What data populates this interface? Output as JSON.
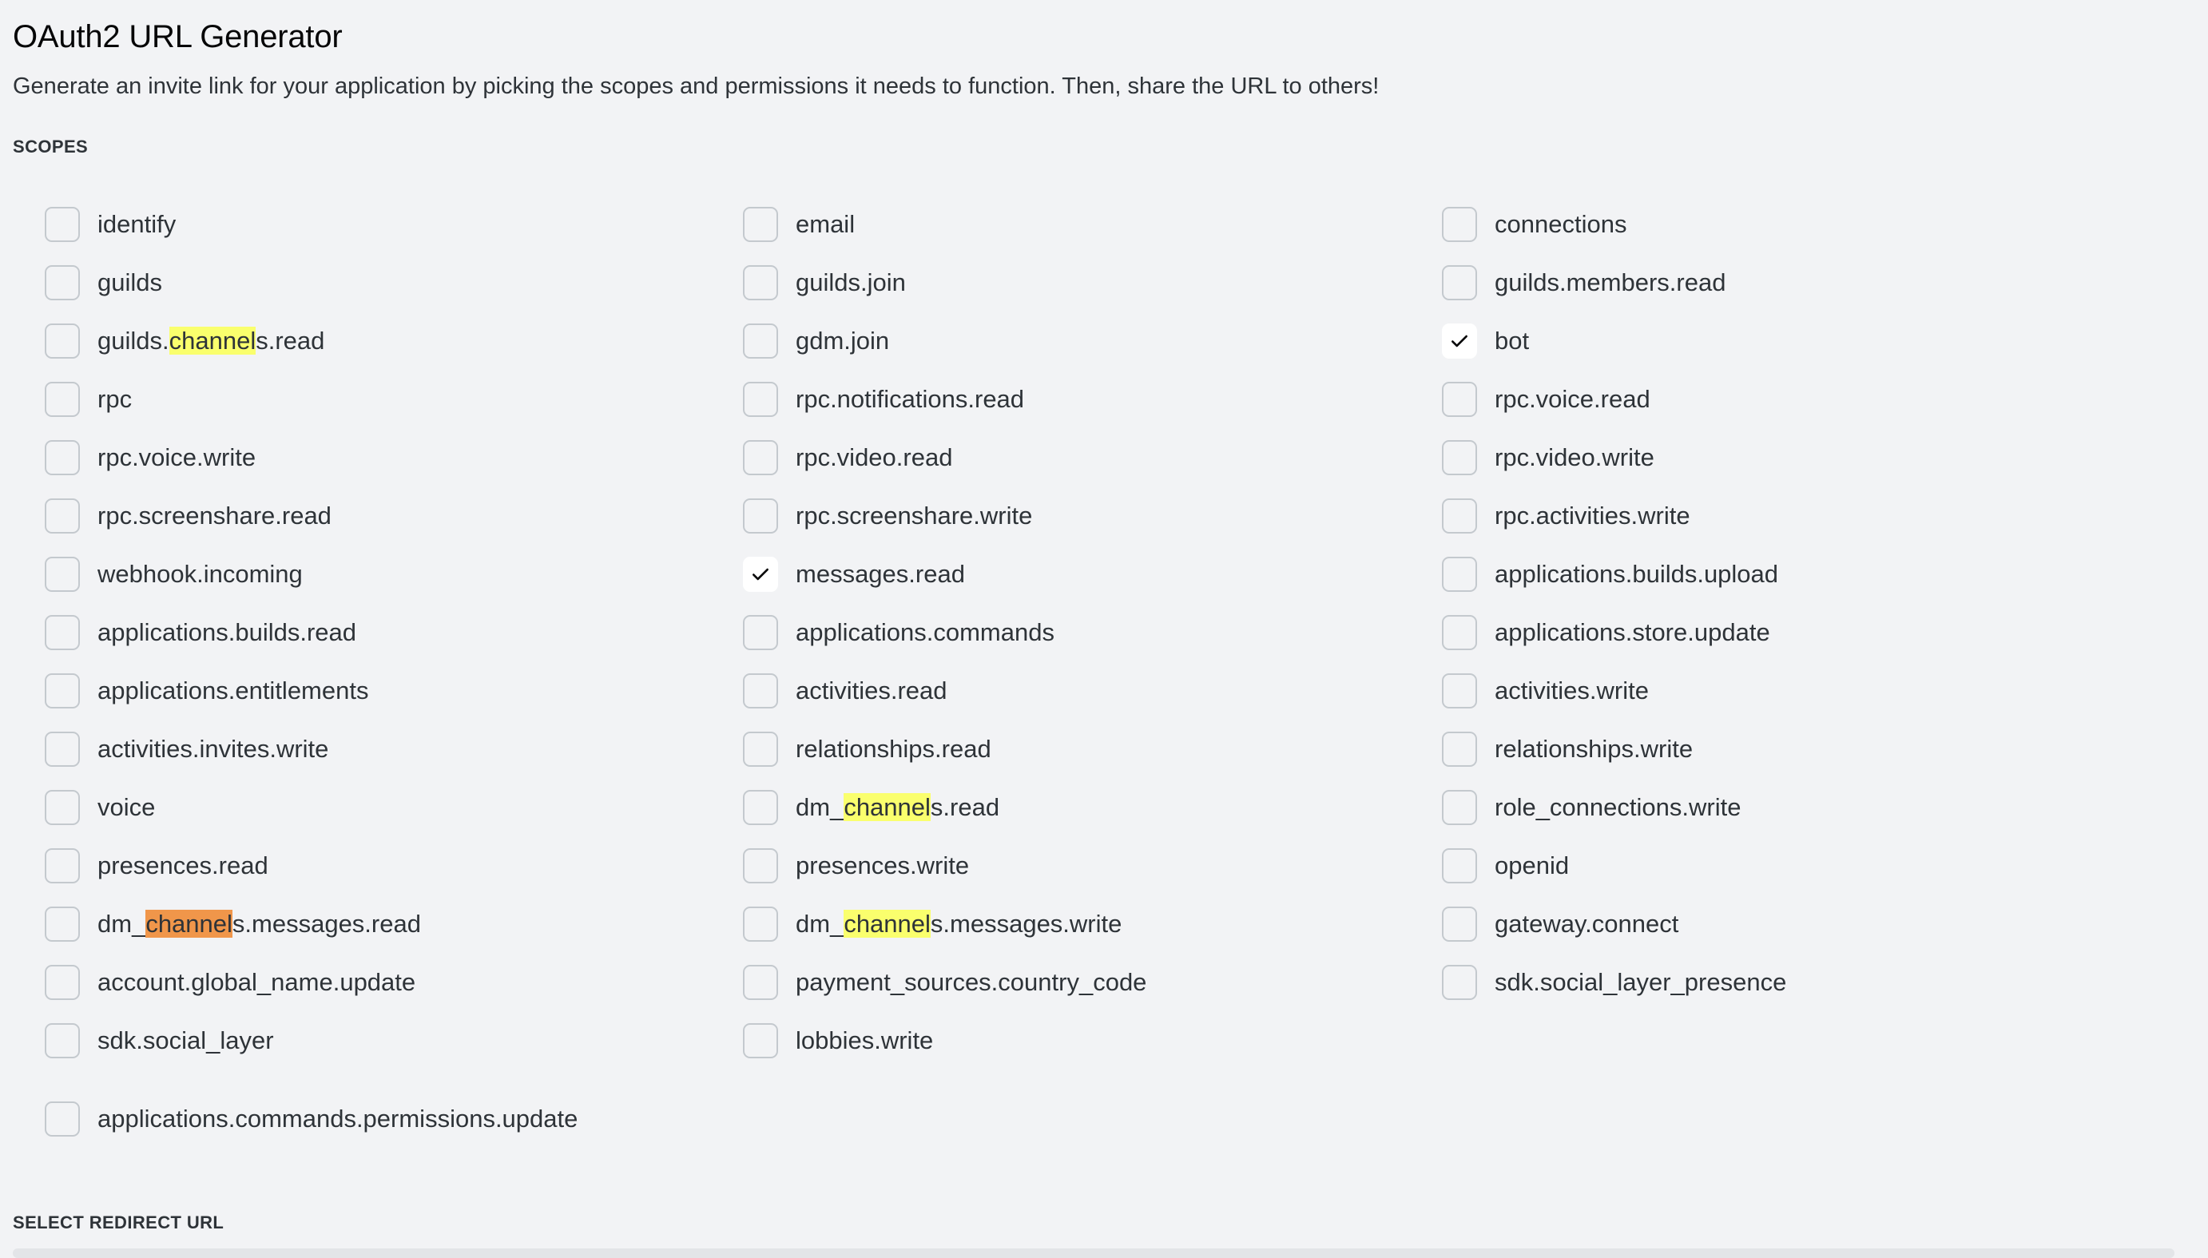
{
  "header": {
    "title": "OAuth2 URL Generator",
    "subtitle": "Generate an invite link for your application by picking the scopes and permissions it needs to function. Then, share the URL to others!"
  },
  "scopes_section": {
    "label": "SCOPES",
    "search_highlight": "channel",
    "columns": [
      [
        {
          "label": "identify",
          "checked": false
        },
        {
          "label": "guilds",
          "checked": false
        },
        {
          "label": "guilds.channels.read",
          "checked": false
        },
        {
          "label": "rpc",
          "checked": false
        },
        {
          "label": "rpc.voice.write",
          "checked": false
        },
        {
          "label": "rpc.screenshare.read",
          "checked": false
        },
        {
          "label": "webhook.incoming",
          "checked": false
        },
        {
          "label": "applications.builds.read",
          "checked": false
        },
        {
          "label": "applications.entitlements",
          "checked": false
        },
        {
          "label": "activities.invites.write",
          "checked": false
        },
        {
          "label": "voice",
          "checked": false
        },
        {
          "label": "presences.read",
          "checked": false
        },
        {
          "label": "dm_channels.messages.read",
          "checked": false,
          "active_match": true
        },
        {
          "label": "account.global_name.update",
          "checked": false
        },
        {
          "label": "sdk.social_layer",
          "checked": false
        }
      ],
      [
        {
          "label": "email",
          "checked": false
        },
        {
          "label": "guilds.join",
          "checked": false
        },
        {
          "label": "gdm.join",
          "checked": false
        },
        {
          "label": "rpc.notifications.read",
          "checked": false
        },
        {
          "label": "rpc.video.read",
          "checked": false
        },
        {
          "label": "rpc.screenshare.write",
          "checked": false
        },
        {
          "label": "messages.read",
          "checked": true
        },
        {
          "label": "applications.commands",
          "checked": false
        },
        {
          "label": "activities.read",
          "checked": false
        },
        {
          "label": "relationships.read",
          "checked": false
        },
        {
          "label": "dm_channels.read",
          "checked": false
        },
        {
          "label": "presences.write",
          "checked": false
        },
        {
          "label": "dm_channels.messages.write",
          "checked": false
        },
        {
          "label": "payment_sources.country_code",
          "checked": false
        },
        {
          "label": "lobbies.write",
          "checked": false
        }
      ],
      [
        {
          "label": "connections",
          "checked": false
        },
        {
          "label": "guilds.members.read",
          "checked": false
        },
        {
          "label": "bot",
          "checked": true
        },
        {
          "label": "rpc.voice.read",
          "checked": false
        },
        {
          "label": "rpc.video.write",
          "checked": false
        },
        {
          "label": "rpc.activities.write",
          "checked": false
        },
        {
          "label": "applications.builds.upload",
          "checked": false
        },
        {
          "label": "applications.store.update",
          "checked": false
        },
        {
          "label": "activities.write",
          "checked": false
        },
        {
          "label": "relationships.write",
          "checked": false
        },
        {
          "label": "role_connections.write",
          "checked": false
        },
        {
          "label": "openid",
          "checked": false
        },
        {
          "label": "gateway.connect",
          "checked": false
        },
        {
          "label": "sdk.social_layer_presence",
          "checked": false
        }
      ]
    ],
    "extra": {
      "label": "applications.commands.permissions.update",
      "checked": false
    }
  },
  "redirect_section": {
    "label": "SELECT REDIRECT URL"
  },
  "colors": {
    "background": "#f2f3f5",
    "highlight": "#faff6d",
    "active_highlight": "#f0964a",
    "checkbox_border": "#c4c9ce"
  }
}
